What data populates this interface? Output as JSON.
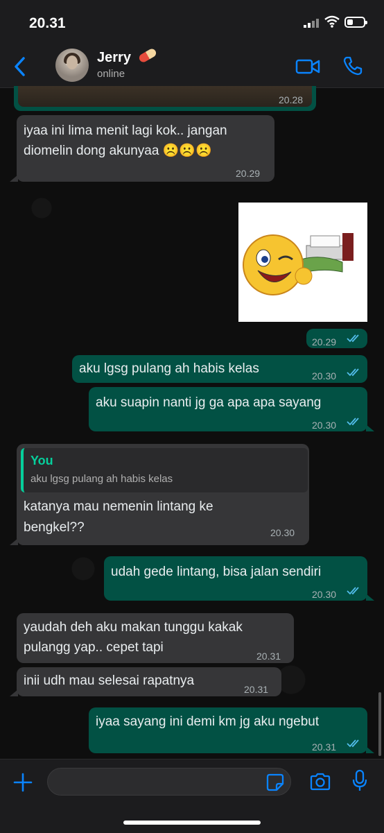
{
  "status_bar": {
    "time": "20.31"
  },
  "header": {
    "contact_name": "Jerry",
    "presence": "online"
  },
  "messages": [
    {
      "dir": "out",
      "kind": "photo",
      "time": "20.28"
    },
    {
      "dir": "in",
      "text": "iyaa ini lima menit lagi kok.. jangan\ndiomelin dong akunyaa ☹️☹️☹️",
      "time": "20.29"
    },
    {
      "dir": "out",
      "kind": "sticker",
      "time": "20.29"
    },
    {
      "dir": "out",
      "text": "aku lgsg pulang ah habis kelas",
      "time": "20.30"
    },
    {
      "dir": "out",
      "text": "aku suapin nanti jg ga apa apa sayang",
      "time": "20.30"
    },
    {
      "dir": "in",
      "reply_to": {
        "author": "You",
        "text": "aku lgsg pulang ah habis kelas"
      },
      "text": "katanya mau nemenin lintang ke\nbengkel??",
      "time": "20.30"
    },
    {
      "dir": "out",
      "text": "udah gede lintang, bisa jalan sendiri",
      "time": "20.30"
    },
    {
      "dir": "in",
      "text": "yaudah deh aku makan tunggu kakak\npulangg yap.. cepet tapi",
      "time": "20.31"
    },
    {
      "dir": "in",
      "text": "inii udh mau selesai rapatnya",
      "time": "20.31"
    },
    {
      "dir": "out",
      "text": "iyaa sayang ini demi km jg aku ngebut",
      "time": "20.31"
    }
  ],
  "colors": {
    "incoming": "#363638",
    "outgoing": "#025144",
    "accent": "#0a84ff",
    "quote": "#06cf9c"
  },
  "icons": [
    "back-chevron-icon",
    "video-call-icon",
    "phone-icon",
    "plus-icon",
    "sticker-icon",
    "camera-icon",
    "microphone-icon",
    "double-check-icon"
  ]
}
